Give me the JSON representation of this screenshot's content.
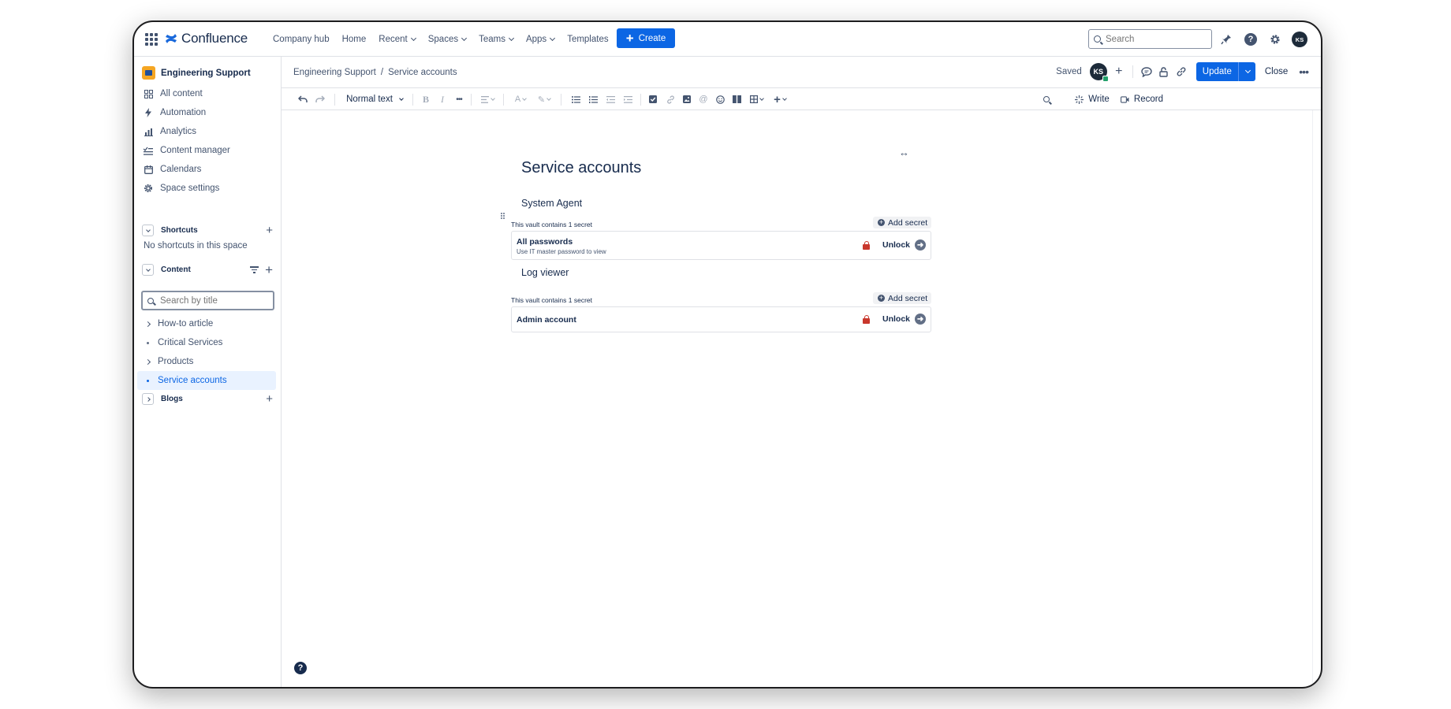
{
  "app": {
    "name": "Confluence",
    "accent": "#0c66e4"
  },
  "topnav": {
    "links": [
      {
        "label": "Company hub"
      },
      {
        "label": "Home"
      },
      {
        "label": "Recent",
        "dropdown": true
      },
      {
        "label": "Spaces",
        "dropdown": true
      },
      {
        "label": "Teams",
        "dropdown": true
      },
      {
        "label": "Apps",
        "dropdown": true
      },
      {
        "label": "Templates"
      }
    ],
    "create_label": "Create",
    "search_placeholder": "Search",
    "icons": [
      "notifications-icon",
      "help-icon",
      "settings-icon"
    ],
    "avatar_initials": "KS"
  },
  "sidebar": {
    "space_name": "Engineering Support",
    "items": [
      {
        "label": "All content",
        "icon": "all-content-icon"
      },
      {
        "label": "Automation",
        "icon": "bolt-icon"
      },
      {
        "label": "Analytics",
        "icon": "chart-icon"
      },
      {
        "label": "Content manager",
        "icon": "content-manager-icon"
      },
      {
        "label": "Calendars",
        "icon": "calendar-icon"
      },
      {
        "label": "Space settings",
        "icon": "gear-icon"
      }
    ],
    "shortcuts": {
      "title": "Shortcuts",
      "empty_text": "No shortcuts in this space"
    },
    "content": {
      "title": "Content",
      "search_placeholder": "Search by title",
      "tree": [
        {
          "label": "How-to article",
          "expandable": true,
          "active": false
        },
        {
          "label": "Critical Services",
          "expandable": false,
          "active": false
        },
        {
          "label": "Products",
          "expandable": true,
          "active": false
        },
        {
          "label": "Service accounts",
          "expandable": false,
          "active": true
        }
      ]
    },
    "blogs": {
      "title": "Blogs"
    }
  },
  "page_header": {
    "breadcrumb": [
      "Engineering Support",
      "Service accounts"
    ],
    "separator": "/",
    "saved_label": "Saved",
    "collaborator_initials": "KS",
    "update_label": "Update",
    "close_label": "Close"
  },
  "toolbar": {
    "text_style": "Normal text",
    "write_label": "Write",
    "record_label": "Record"
  },
  "editor": {
    "title": "Service accounts",
    "sections": [
      {
        "heading": "System Agent",
        "vault_note": "This vault contains 1 secret",
        "add_secret_label": "Add secret",
        "secret": {
          "name": "All passwords",
          "subtitle": "Use IT master password to view",
          "unlock_label": "Unlock"
        }
      },
      {
        "heading": "Log viewer",
        "vault_note": "This vault contains 1 secret",
        "add_secret_label": "Add secret",
        "secret": {
          "name": "Admin account",
          "subtitle": "",
          "unlock_label": "Unlock"
        }
      }
    ]
  }
}
